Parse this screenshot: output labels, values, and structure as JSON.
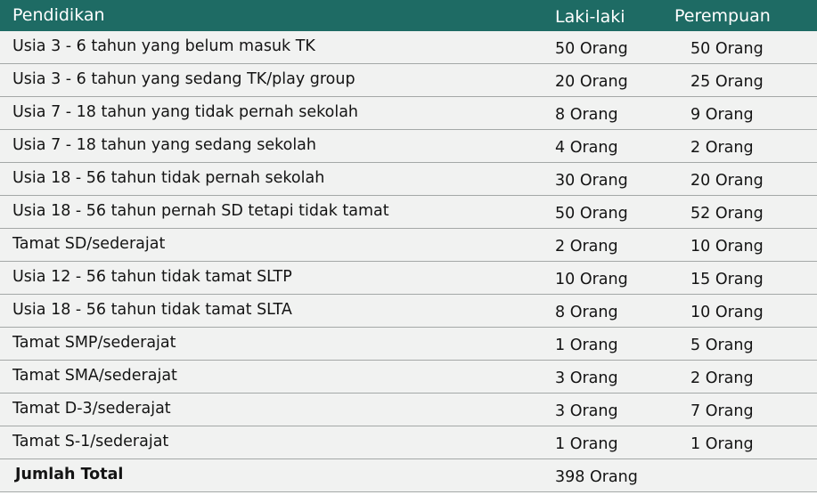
{
  "header": {
    "col1": "Pendidikan",
    "col2": "Laki-laki",
    "col3": "Perempuan"
  },
  "rows": [
    {
      "label": "Usia 3 - 6 tahun yang belum masuk TK",
      "male": "50 Orang",
      "female": "50 Orang"
    },
    {
      "label": "Usia 3 - 6 tahun yang sedang TK/play group",
      "male": "20 Orang",
      "female": "25 Orang"
    },
    {
      "label": "Usia 7 - 18 tahun yang tidak pernah sekolah",
      "male": "8 Orang",
      "female": "9 Orang"
    },
    {
      "label": "Usia 7 - 18 tahun yang sedang sekolah",
      "male": "4 Orang",
      "female": "2 Orang"
    },
    {
      "label": "Usia 18 - 56 tahun tidak pernah sekolah",
      "male": "30 Orang",
      "female": "20 Orang"
    },
    {
      "label": "Usia 18 - 56 tahun pernah SD tetapi tidak tamat",
      "male": "50 Orang",
      "female": "52 Orang"
    },
    {
      "label": "Tamat SD/sederajat",
      "male": "2 Orang",
      "female": "10 Orang"
    },
    {
      "label": "Usia 12 - 56 tahun tidak tamat SLTP",
      "male": "10 Orang",
      "female": "15 Orang"
    },
    {
      "label": "Usia 18 - 56 tahun tidak tamat SLTA",
      "male": "8 Orang",
      "female": "10 Orang"
    },
    {
      "label": "Tamat SMP/sederajat",
      "male": "1 Orang",
      "female": "5 Orang"
    },
    {
      "label": "Tamat SMA/sederajat",
      "male": "3 Orang",
      "female": "2 Orang"
    },
    {
      "label": "Tamat D-3/sederajat",
      "male": "3 Orang",
      "female": "7 Orang"
    },
    {
      "label": "Tamat S-1/sederajat",
      "male": "1 Orang",
      "female": "1 Orang"
    }
  ],
  "total": {
    "label": "Jumlah Total",
    "value": "398 Orang"
  },
  "colors": {
    "header_bg": "#1e6b64",
    "row_bg": "#f1f2f1",
    "divider": "#a4a8a7"
  }
}
